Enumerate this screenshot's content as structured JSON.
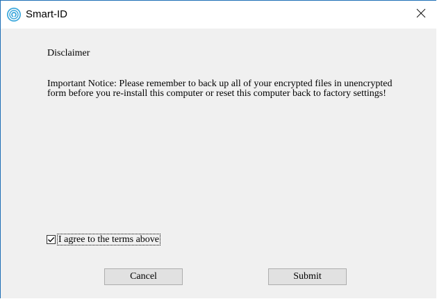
{
  "window": {
    "title": "Smart-ID",
    "app_icon": "smart-id-icon",
    "close_icon": "close-icon"
  },
  "dialog": {
    "heading": "Disclaimer",
    "notice": "Important Notice:  Please remember to back up all of your encrypted files in unencrypted form before you re-install this computer or reset this computer back to factory settings!",
    "agree": {
      "label": "I agree to the terms above",
      "checked": true
    },
    "buttons": {
      "cancel_label": "Cancel",
      "submit_label": "Submit"
    }
  },
  "colors": {
    "accent": "#1e6fb6",
    "window_background": "#f0f0f0",
    "button_face": "#e1e1e1",
    "button_border": "#adadad"
  }
}
